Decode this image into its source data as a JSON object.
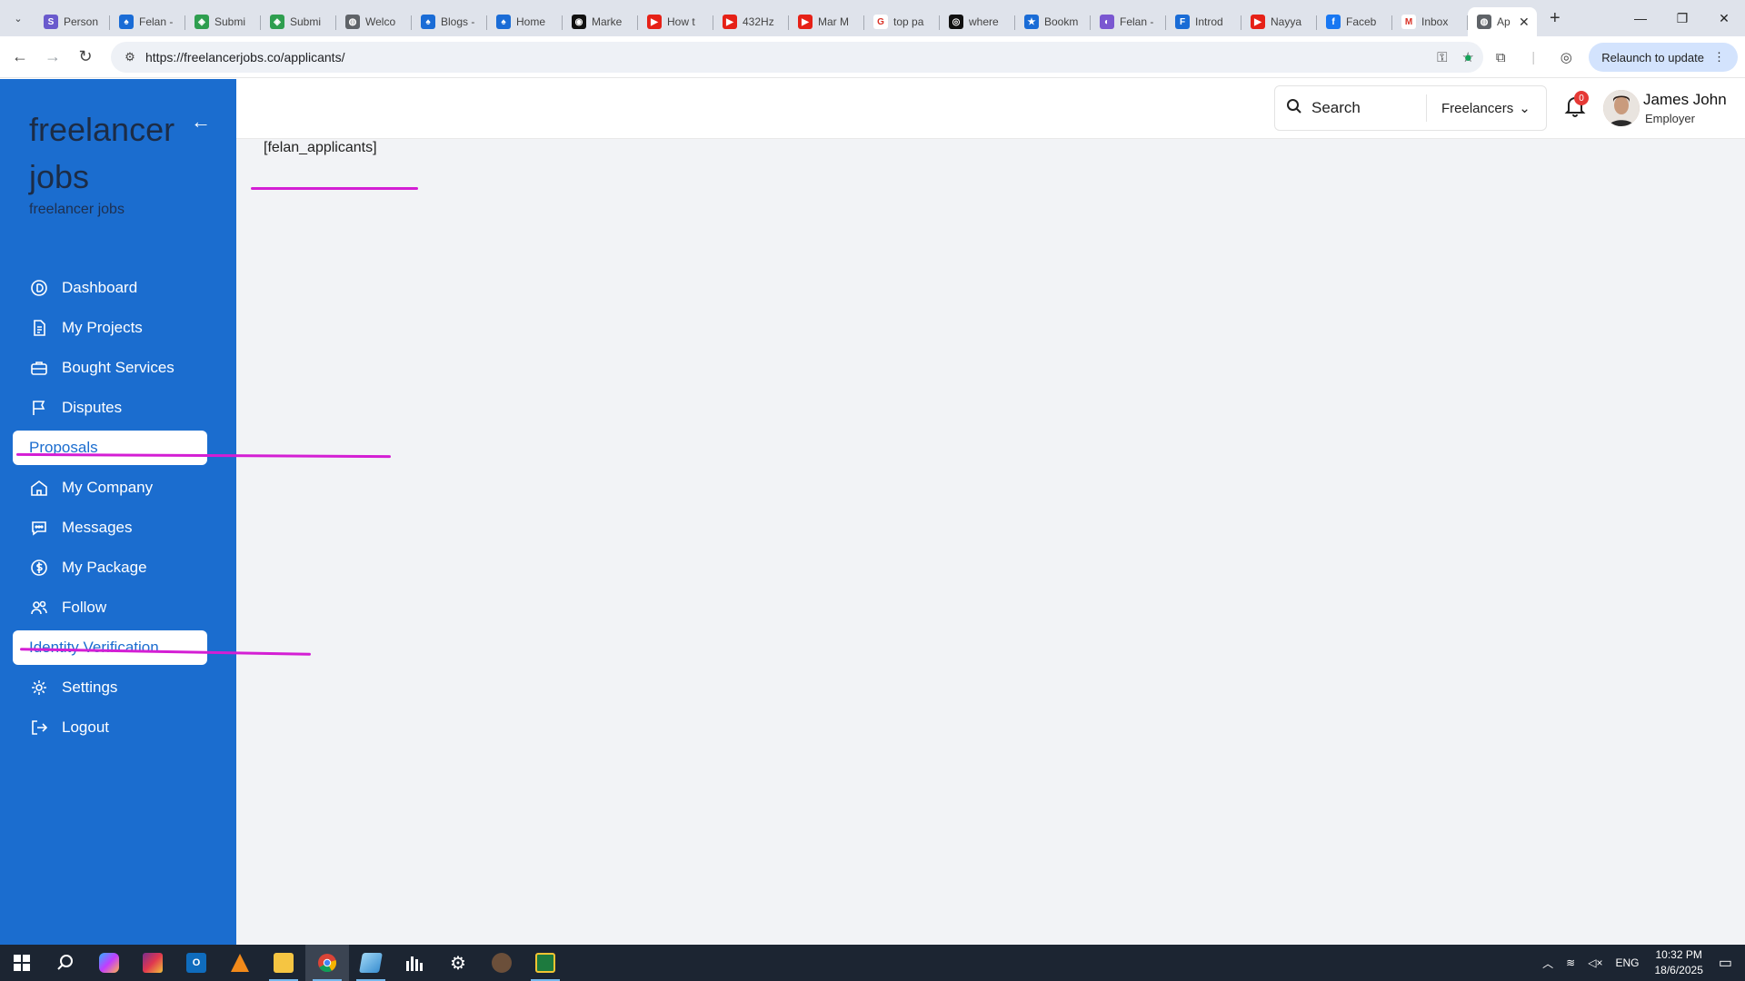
{
  "browser": {
    "tabs": [
      {
        "title": "Person",
        "fav_color": "#6a5acd",
        "fav_char": "S"
      },
      {
        "title": "Felan -",
        "fav_color": "#1a6cd6",
        "fav_char": "♠"
      },
      {
        "title": "Submi",
        "fav_color": "#2e9e4f",
        "fav_char": "◈"
      },
      {
        "title": "Submi",
        "fav_color": "#2e9e4f",
        "fav_char": "◈"
      },
      {
        "title": "Welco",
        "fav_color": "#5f6368",
        "fav_char": "◍"
      },
      {
        "title": "Blogs -",
        "fav_color": "#1a6cd6",
        "fav_char": "♠"
      },
      {
        "title": "Home",
        "fav_color": "#1a6cd6",
        "fav_char": "♠"
      },
      {
        "title": "Marke",
        "fav_color": "#111111",
        "fav_char": "◉"
      },
      {
        "title": "How t",
        "fav_color": "#e62117",
        "fav_char": "▶"
      },
      {
        "title": "432Hz",
        "fav_color": "#e62117",
        "fav_char": "▶"
      },
      {
        "title": "Mar M",
        "fav_color": "#e62117",
        "fav_char": "▶"
      },
      {
        "title": "top pa",
        "fav_color": "#ffffff",
        "fav_char": "G"
      },
      {
        "title": "where",
        "fav_color": "#111111",
        "fav_char": "◎"
      },
      {
        "title": "Bookm",
        "fav_color": "#1a6cd6",
        "fav_char": "★"
      },
      {
        "title": "Felan -",
        "fav_color": "#7a57d1",
        "fav_char": "◐"
      },
      {
        "title": "Introd",
        "fav_color": "#1a6cd6",
        "fav_char": "F"
      },
      {
        "title": "Nayya",
        "fav_color": "#e62117",
        "fav_char": "▶"
      },
      {
        "title": "Faceb",
        "fav_color": "#1877f2",
        "fav_char": "f"
      },
      {
        "title": "Inbox",
        "fav_color": "#ffffff",
        "fav_char": "M"
      }
    ],
    "active_tab": {
      "title": "Ap",
      "fav_char": "◍"
    },
    "url": "https://freelancerjobs.co/applicants/",
    "relaunch_label": "Relaunch to update"
  },
  "sidebar": {
    "brand": "freelancer jobs",
    "brand_sub": "freelancer jobs",
    "items": [
      {
        "label": "Dashboard",
        "icon": "dashboard-icon"
      },
      {
        "label": "My Projects",
        "icon": "document-icon"
      },
      {
        "label": "Bought Services",
        "icon": "briefcase-icon"
      },
      {
        "label": "Disputes",
        "icon": "flag-icon"
      },
      {
        "label": "Proposals",
        "icon": "",
        "highlighted": true
      },
      {
        "label": "My Company",
        "icon": "home-icon"
      },
      {
        "label": "Messages",
        "icon": "chat-icon"
      },
      {
        "label": "My Package",
        "icon": "dollar-icon"
      },
      {
        "label": "Follow",
        "icon": "users-icon"
      },
      {
        "label": "Identity Verification",
        "icon": "",
        "highlighted": true
      },
      {
        "label": "Settings",
        "icon": "gear-icon"
      },
      {
        "label": "Logout",
        "icon": "logout-icon"
      }
    ]
  },
  "header": {
    "search_placeholder": "Search",
    "search_category": "Freelancers",
    "notification_count": "0",
    "user_name": "James John",
    "user_role": "Employer"
  },
  "main": {
    "shortcode": "[felan_applicants]"
  },
  "taskbar": {
    "lang": "ENG",
    "time": "10:32 PM",
    "date": "18/6/2025"
  },
  "colors": {
    "sidebar_bg": "#1b6dcf",
    "annotation_ink": "#d41ed4",
    "badge_red": "#e53935"
  }
}
